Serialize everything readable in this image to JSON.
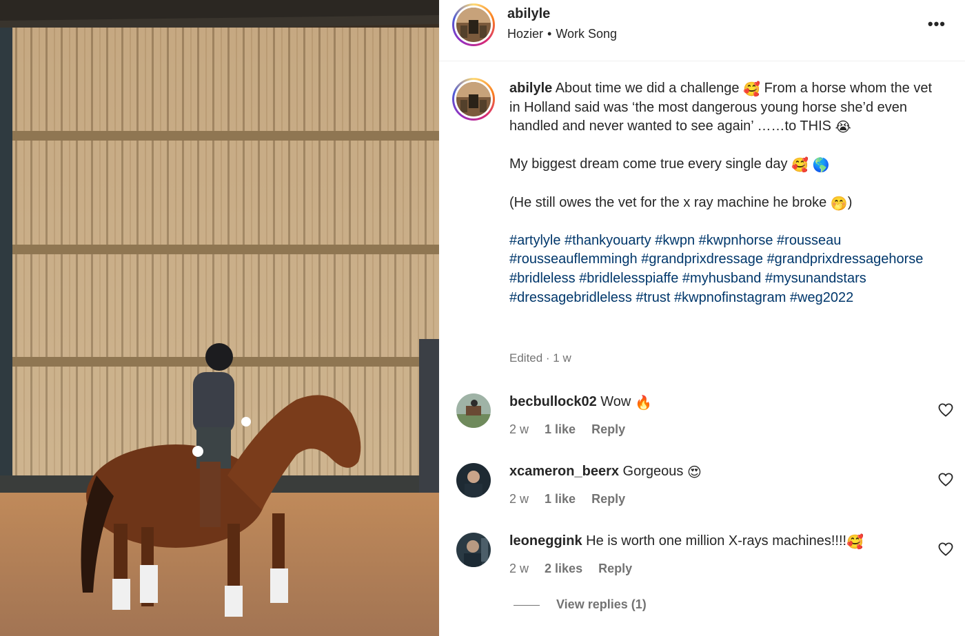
{
  "post": {
    "username": "abilyle",
    "audio_artist": "Hozier",
    "audio_separator": "•",
    "audio_track": "Work Song",
    "more_icon": "•••"
  },
  "caption": {
    "username": "abilyle",
    "line1_text": "About time we did a challenge",
    "line1_emoji": "🥰",
    "line1_rest": "From a horse whom the vet in Holland said was ‘the most dangerous young horse she’d even handled and never wanted to see again’ ……to THIS",
    "line1_end_emoji": "😭",
    "line2_text": "My biggest dream come true every single day",
    "line2_emoji1": "🥰",
    "line2_emoji2": "🌎",
    "line3_text": "(He still owes the vet for the x ray machine he broke",
    "line3_emoji": "🤭",
    "line3_close": ")",
    "hashtags": [
      "#artylyle",
      "#thankyouarty",
      "#kwpn",
      "#kwpnhorse",
      "#rousseau",
      "#rousseauflemmingh",
      "#grandprixdressage",
      "#grandprixdressagehorse",
      "#bridleless",
      "#bridlelesspiaffe",
      "#myhusband",
      "#mysunandstars",
      "#dressagebridleless",
      "#trust",
      "#kwpnofinstagram",
      "#weg2022"
    ],
    "meta": "Edited · 1 w"
  },
  "comments": [
    {
      "username": "becbullock02",
      "text": "Wow",
      "emoji": "🔥",
      "time": "2 w",
      "likes": "1 like",
      "reply": "Reply"
    },
    {
      "username": "xcameron_beerx",
      "text": "Gorgeous",
      "emoji": "😍",
      "time": "2 w",
      "likes": "1 like",
      "reply": "Reply"
    },
    {
      "username": "leoneggink",
      "text": "He is worth one million X-rays machines!!!!",
      "emoji": "🥰",
      "time": "2 w",
      "likes": "2 likes",
      "reply": "Reply"
    }
  ],
  "view_replies": "View replies (1)",
  "icons": {
    "like": "heart-outline-icon",
    "more": "more-options-icon"
  },
  "colors": {
    "hashtag": "#00376b",
    "muted": "#737373",
    "text": "#262626"
  }
}
